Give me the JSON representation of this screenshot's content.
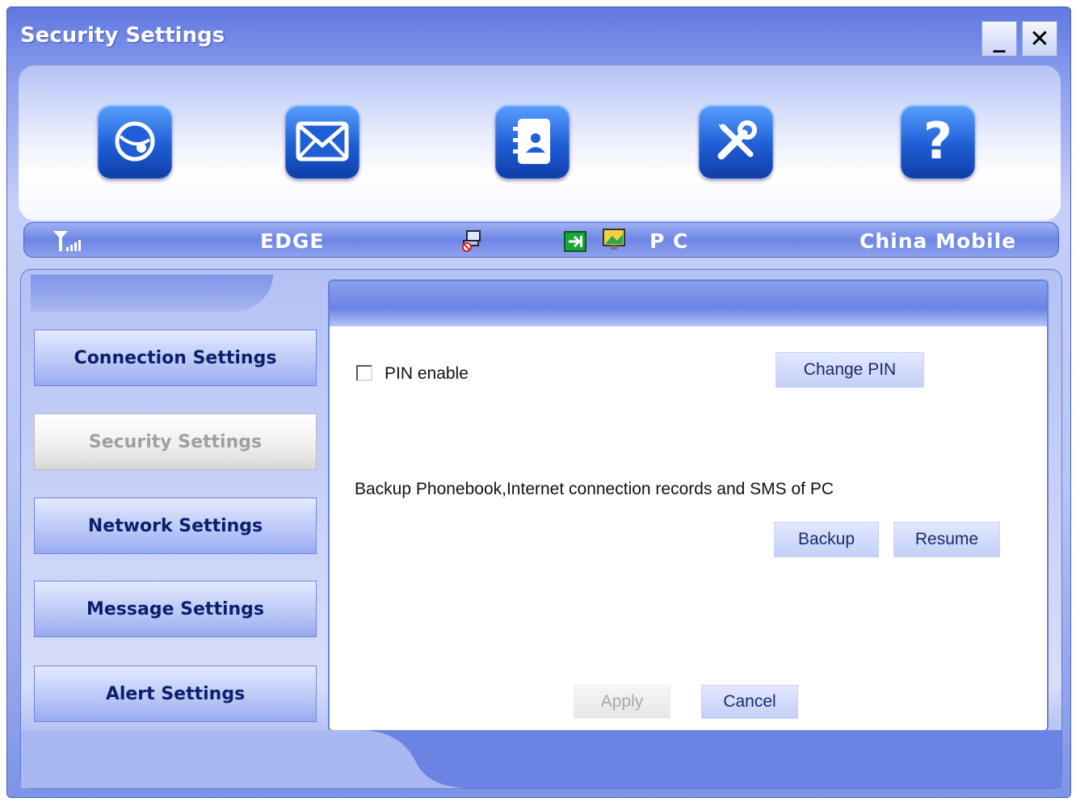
{
  "window": {
    "title": "Security Settings",
    "minimize_label": "_",
    "close_label": "✕"
  },
  "toolbar": {
    "icons": [
      "internet-icon",
      "messages-icon",
      "phonebook-icon",
      "settings-icon",
      "help-icon"
    ]
  },
  "status": {
    "network_type": "EDGE",
    "mode": "P C",
    "operator": "China Mobile"
  },
  "sidebar": {
    "items": [
      {
        "label": "Connection Settings",
        "active": false
      },
      {
        "label": "Security Settings",
        "active": true
      },
      {
        "label": "Network Settings",
        "active": false
      },
      {
        "label": "Message Settings",
        "active": false
      },
      {
        "label": "Alert Settings",
        "active": false
      }
    ]
  },
  "security": {
    "pin_enable_label": "PIN enable",
    "pin_enabled": false,
    "change_pin_label": "Change PIN",
    "backup_description": "Backup Phonebook,Internet connection records and SMS of PC",
    "backup_label": "Backup",
    "resume_label": "Resume",
    "apply_label": "Apply",
    "cancel_label": "Cancel"
  }
}
